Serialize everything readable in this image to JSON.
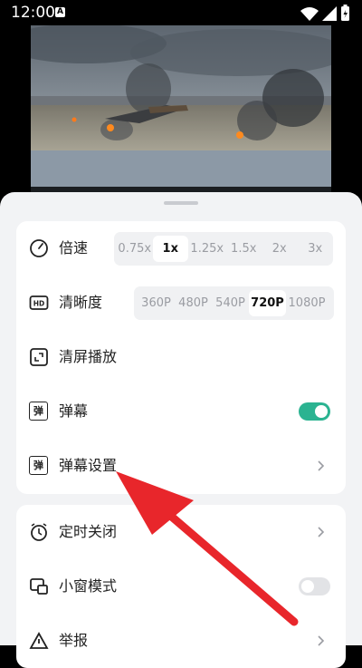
{
  "status_bar": {
    "time": "12:00",
    "notification_icon": "A"
  },
  "video": {
    "description_icon": "battlefield-video-frame"
  },
  "panel1": {
    "speed": {
      "label": "倍速",
      "options": [
        "0.75x",
        "1x",
        "1.25x",
        "1.5x",
        "2x",
        "3x"
      ],
      "selected": "1x"
    },
    "quality": {
      "label": "清晰度",
      "options": [
        "360P",
        "480P",
        "540P",
        "720P",
        "1080P"
      ],
      "selected": "720P"
    },
    "clear_screen": {
      "label": "清屏播放"
    },
    "danmaku": {
      "label": "弹幕",
      "icon_text": "弹",
      "enabled": true
    },
    "danmaku_settings": {
      "label": "弹幕设置",
      "icon_text": "弹"
    }
  },
  "panel2": {
    "timer": {
      "label": "定时关闭"
    },
    "mini_window": {
      "label": "小窗模式",
      "enabled": false
    },
    "report": {
      "label": "举报"
    }
  },
  "colors": {
    "accent": "#2bb391",
    "annotation_arrow": "#e8262b"
  }
}
